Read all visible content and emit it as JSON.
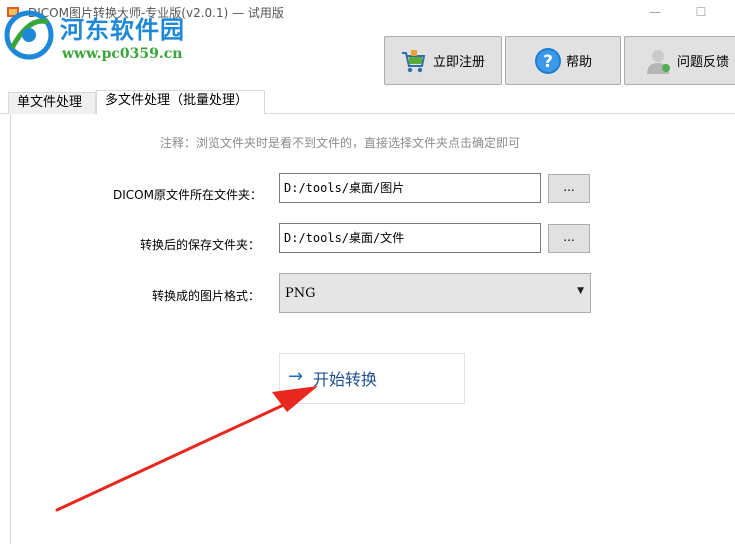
{
  "window": {
    "title": "DICOM图片转换大师-专业版(v2.0.1) — 试用版",
    "minimize_glyph": "—",
    "maximize_glyph": "☐"
  },
  "watermark": {
    "title": "河东软件园",
    "url": "www.pc0359.cn"
  },
  "toolbar": {
    "register_label": "立即注册",
    "register_icon": "cart-icon",
    "help_label": "帮助",
    "help_icon": "question-icon",
    "feedback_label": "问题反馈",
    "feedback_icon": "user-icon"
  },
  "tabs": [
    {
      "label": "单文件处理",
      "active": false
    },
    {
      "label": "多文件处理（批量处理）",
      "active": true
    }
  ],
  "form": {
    "note": "注释：浏览文件夹时是看不到文件的，直接选择文件夹点击确定即可",
    "source_label": "DICOM原文件所在文件夹：",
    "source_value": "D:/tools/桌面/图片",
    "dest_label": "转换后的保存文件夹：",
    "dest_value": "D:/tools/桌面/文件",
    "browse_label": "...",
    "format_label": "转换成的图片格式：",
    "format_value": "PNG",
    "start_arrow": "→",
    "start_label": "开始转换"
  },
  "colors": {
    "accent_blue": "#1f6fc0",
    "annotation_red": "#e8281f",
    "watermark_blue": "#1e88d8",
    "watermark_green": "#3aa63a"
  }
}
